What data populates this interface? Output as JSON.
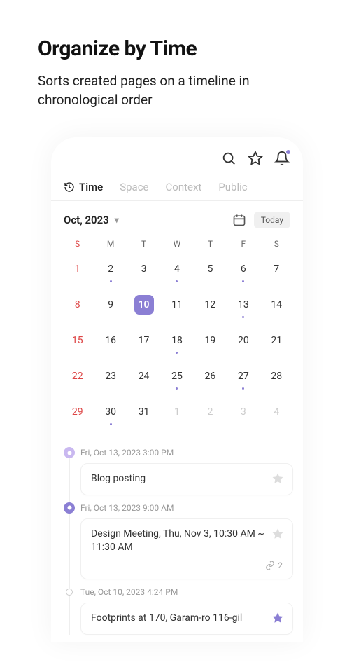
{
  "header": {
    "title": "Organize by Time",
    "subtitle": "Sorts created pages on a timeline in chronological order"
  },
  "tabs": {
    "items": [
      "Time",
      "Space",
      "Context",
      "Public"
    ],
    "active": 0
  },
  "calendar": {
    "month_label": "Oct, 2023",
    "today_label": "Today",
    "dow": [
      "S",
      "M",
      "T",
      "W",
      "T",
      "F",
      "S"
    ],
    "weeks": [
      [
        {
          "n": "1",
          "sun": true
        },
        {
          "n": "2",
          "dot": true
        },
        {
          "n": "3"
        },
        {
          "n": "4",
          "dot": true
        },
        {
          "n": "5"
        },
        {
          "n": "6",
          "dot": true
        },
        {
          "n": "7"
        }
      ],
      [
        {
          "n": "8",
          "sun": true
        },
        {
          "n": "9"
        },
        {
          "n": "10",
          "selected": true
        },
        {
          "n": "11"
        },
        {
          "n": "12"
        },
        {
          "n": "13",
          "dot": true
        },
        {
          "n": "14"
        }
      ],
      [
        {
          "n": "15",
          "sun": true
        },
        {
          "n": "16"
        },
        {
          "n": "17"
        },
        {
          "n": "18",
          "dot": true
        },
        {
          "n": "19"
        },
        {
          "n": "20"
        },
        {
          "n": "21"
        }
      ],
      [
        {
          "n": "22",
          "sun": true
        },
        {
          "n": "23"
        },
        {
          "n": "24"
        },
        {
          "n": "25",
          "dot": true
        },
        {
          "n": "26"
        },
        {
          "n": "27",
          "dot": true
        },
        {
          "n": "28"
        }
      ],
      [
        {
          "n": "29",
          "sun": true
        },
        {
          "n": "30",
          "dot": true
        },
        {
          "n": "31"
        },
        {
          "n": "1",
          "other": true
        },
        {
          "n": "2",
          "other": true
        },
        {
          "n": "3",
          "other": true
        },
        {
          "n": "4",
          "other": true
        }
      ]
    ]
  },
  "timeline": {
    "items": [
      {
        "badge": "purple-light",
        "time": "Fri, Oct 13, 2023 3:00 PM",
        "title": "Blog posting",
        "starred": false
      },
      {
        "badge": "purple-solid",
        "time": "Fri, Oct 13, 2023 9:00 AM",
        "title": "Design Meeting, Thu, Nov 3, 10:30 AM ~ 11:30 AM",
        "starred": false,
        "link_count": "2"
      },
      {
        "badge": "hollow",
        "time": "Tue, Oct 10, 2023 4:24 PM",
        "title": "Footprints at 170, Garam-ro 116-gil",
        "starred": true
      }
    ]
  }
}
